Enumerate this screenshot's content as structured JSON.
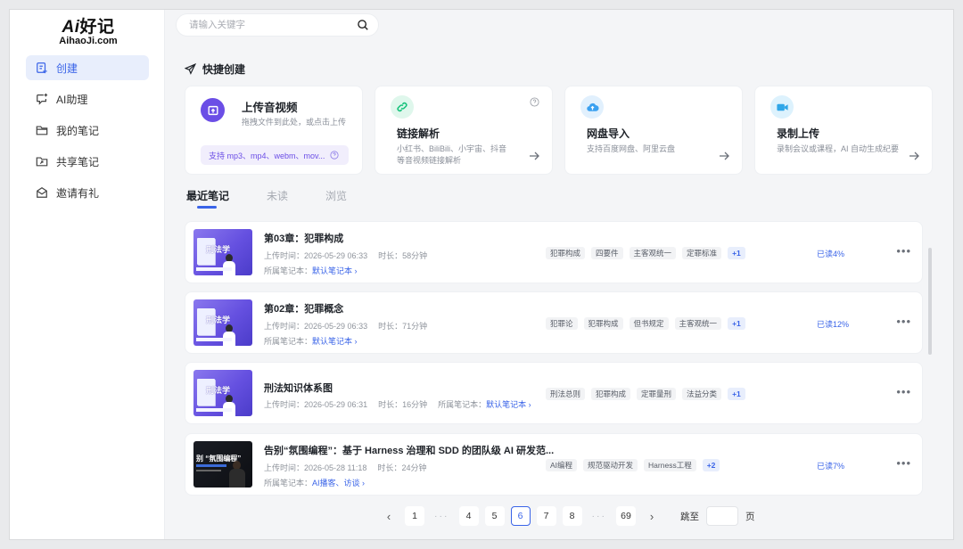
{
  "logo": {
    "main_ai": "Ai",
    "main_rest": "好记",
    "sub": "AihaoJi.com"
  },
  "sidebar": {
    "items": [
      {
        "label": "创建",
        "active": true
      },
      {
        "label": "AI助理"
      },
      {
        "label": "我的笔记"
      },
      {
        "label": "共享笔记"
      },
      {
        "label": "邀请有礼"
      }
    ]
  },
  "search": {
    "placeholder": "请输入关键字"
  },
  "quick_create": {
    "title": "快捷创建",
    "upload": {
      "title": "上传音视频",
      "desc": "拖拽文件到此处，或点击上传",
      "formats": "支持 mp3、mp4、webm、mov..."
    },
    "cards": [
      {
        "title": "链接解析",
        "desc": "小红书、BiliBili、小宇宙、抖音等音视频链接解析"
      },
      {
        "title": "网盘导入",
        "desc": "支持百度网盘、阿里云盘"
      },
      {
        "title": "录制上传",
        "desc": "录制会议或课程，AI 自动生成纪要"
      }
    ]
  },
  "tabs": [
    "最近笔记",
    "未读",
    "浏览"
  ],
  "notes": [
    {
      "title": "第03章：犯罪构成",
      "upload_label": "上传时间：",
      "upload_time": "2026-05-29 06:33",
      "duration_label": "时长：",
      "duration": "58分钟",
      "book_label": "所属笔记本：",
      "book": "默认笔记本 ›",
      "tags": [
        "犯罪构成",
        "四要件",
        "主客观统一",
        "定罪标准"
      ],
      "more_tags": "+1",
      "progress": "已读4%",
      "thumb_text": "刑法学"
    },
    {
      "title": "第02章：犯罪概念",
      "upload_label": "上传时间：",
      "upload_time": "2026-05-29 06:33",
      "duration_label": "时长：",
      "duration": "71分钟",
      "book_label": "所属笔记本：",
      "book": "默认笔记本 ›",
      "tags": [
        "犯罪论",
        "犯罪构成",
        "但书规定",
        "主客观统一"
      ],
      "more_tags": "+1",
      "progress": "已读12%",
      "thumb_text": "刑法学"
    },
    {
      "title": "刑法知识体系图",
      "upload_label": "上传时间：",
      "upload_time": "2026-05-29 06:31",
      "duration_label": "时长：",
      "duration": "16分钟",
      "book_label": "所属笔记本：",
      "book": "默认笔记本 ›",
      "tags": [
        "刑法总则",
        "犯罪构成",
        "定罪量刑",
        "法益分类"
      ],
      "more_tags": "+1",
      "progress": "",
      "thumb_text": "刑法学"
    },
    {
      "title": "告别“氛围编程”：基于 Harness 治理和 SDD 的团队级 AI 研发范...",
      "upload_label": "上传时间：",
      "upload_time": "2026-05-28 11:18",
      "duration_label": "时长：",
      "duration": "24分钟",
      "book_label": "所属笔记本：",
      "book": "AI播客、访谈 ›",
      "tags": [
        "AI编程",
        "规范驱动开发",
        "Harness工程"
      ],
      "more_tags": "+2",
      "progress": "已读7%",
      "thumb_text": "别 “氛围编程”"
    }
  ],
  "pagination": {
    "prev": "‹",
    "next": "›",
    "pages": [
      "1",
      "···",
      "4",
      "5",
      "6",
      "7",
      "8",
      "···",
      "69"
    ],
    "active": "6",
    "jump_label": "跳至",
    "page_unit": "页"
  },
  "colors": {
    "accent": "#3a64e8",
    "purple": "#6b4ee6",
    "green": "#19c37d",
    "sky": "#3aa0f0"
  }
}
